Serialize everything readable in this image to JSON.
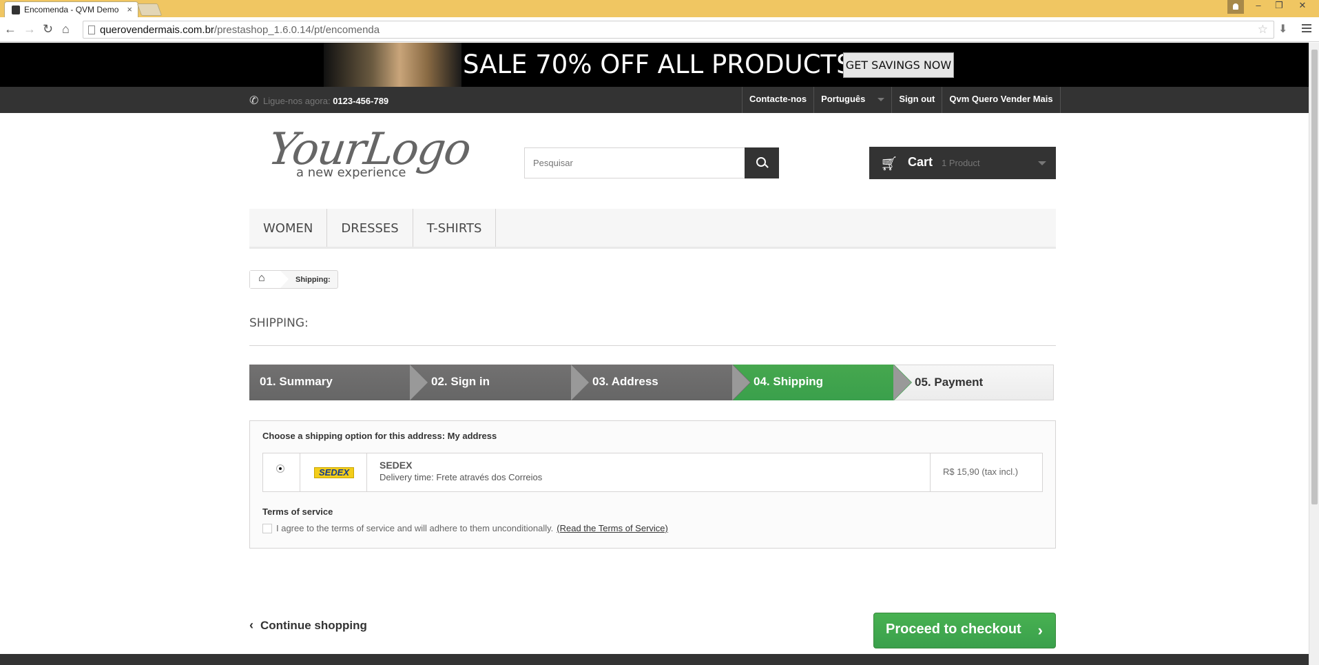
{
  "browser": {
    "tab_title": "Encomenda - QVM Demo",
    "tab_close": "×",
    "url_host": "querovendermais.com.br",
    "url_path": "/prestashop_1.6.0.14/pt/encomenda",
    "win_min": "–",
    "win_restore": "❐",
    "win_close": "✕"
  },
  "promo": {
    "text": "SALE 70% OFF ALL PRODUCTS",
    "button": "GET SAVINGS NOW"
  },
  "topbar": {
    "phone_label": "Ligue-nos agora:",
    "phone_number": "0123-456-789",
    "links": [
      "Contacte-nos",
      "Português",
      "Sign out",
      "Qvm Quero Vender Mais"
    ]
  },
  "logo": {
    "line1": "YourLogo",
    "line2": "a new experience"
  },
  "search": {
    "placeholder": "Pesquisar"
  },
  "cart": {
    "label": "Cart",
    "count": "1 Product"
  },
  "menu": [
    "WOMEN",
    "DRESSES",
    "T-SHIRTS"
  ],
  "breadcrumb": {
    "current": "Shipping:"
  },
  "heading": "SHIPPING:",
  "steps": [
    "01. Summary",
    "02. Sign in",
    "03. Address",
    "04. Shipping",
    "05. Payment"
  ],
  "shipping": {
    "question": "Choose a shipping option for this address: My address",
    "carrier_logo": "SEDEX",
    "carrier_name": "SEDEX",
    "delivery": "Delivery time: Frete através dos Correios",
    "price": "R$ 15,90 (tax incl.)",
    "tos_heading": "Terms of service",
    "tos_text": "I agree to the terms of service and will adhere to them unconditionally.",
    "tos_link": "(Read the Terms of Service)"
  },
  "actions": {
    "continue": "Continue shopping",
    "proceed": "Proceed to checkout"
  }
}
